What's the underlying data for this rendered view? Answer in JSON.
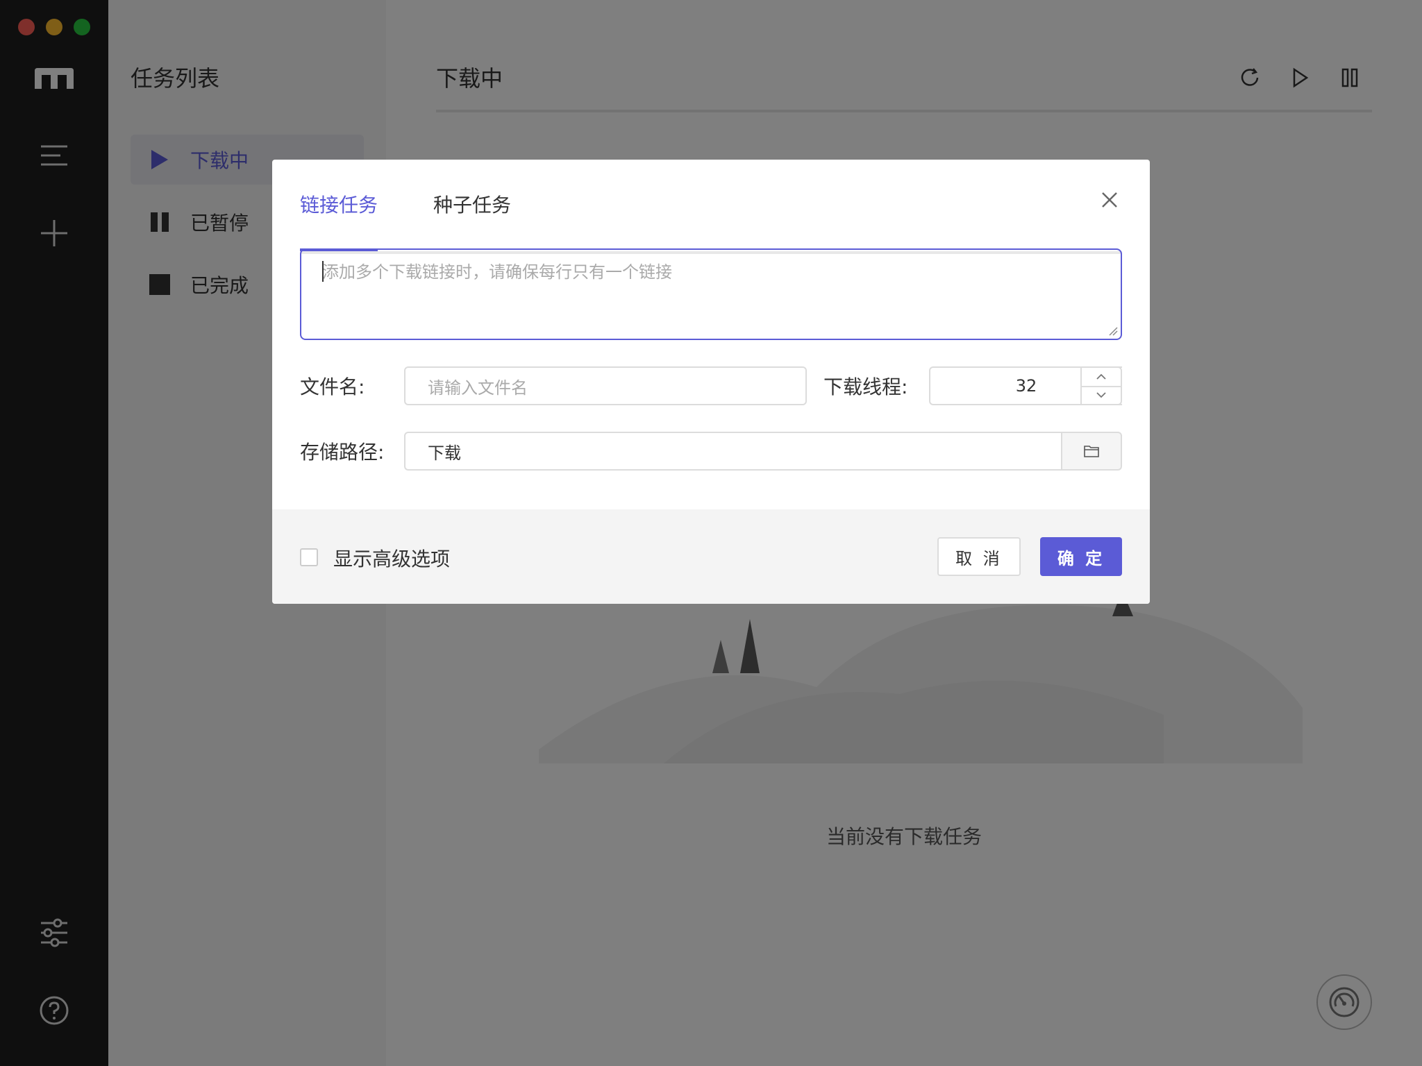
{
  "sidebar": {
    "logo": "motrix-logo",
    "buttons": [
      "menu-icon",
      "add-icon",
      "settings-icon",
      "help-icon"
    ]
  },
  "tasklist": {
    "title": "任务列表",
    "items": [
      {
        "label": "下载中",
        "icon": "play-icon",
        "active": true
      },
      {
        "label": "已暂停",
        "icon": "pause-icon",
        "active": false
      },
      {
        "label": "已完成",
        "icon": "stop-icon",
        "active": false
      }
    ]
  },
  "main": {
    "title": "下载中",
    "empty_text": "当前没有下载任务",
    "tools": [
      "refresh-icon",
      "resume-all-icon",
      "pause-all-icon"
    ]
  },
  "dialog": {
    "tabs": [
      {
        "label": "链接任务",
        "active": true
      },
      {
        "label": "种子任务",
        "active": false
      }
    ],
    "url_placeholder": "添加多个下载链接时，请确保每行只有一个链接",
    "filename_label": "文件名:",
    "filename_placeholder": "请输入文件名",
    "threads_label": "下载线程:",
    "threads_value": "32",
    "path_label": "存储路径:",
    "path_value": "下载",
    "advanced_label": "显示高级选项",
    "advanced_checked": false,
    "cancel_label": "取 消",
    "ok_label": "确 定"
  },
  "colors": {
    "accent": "#5b5bd6",
    "sidebar_bg": "#1f1f1f",
    "overlay": "rgba(0,0,0,0.5)"
  }
}
